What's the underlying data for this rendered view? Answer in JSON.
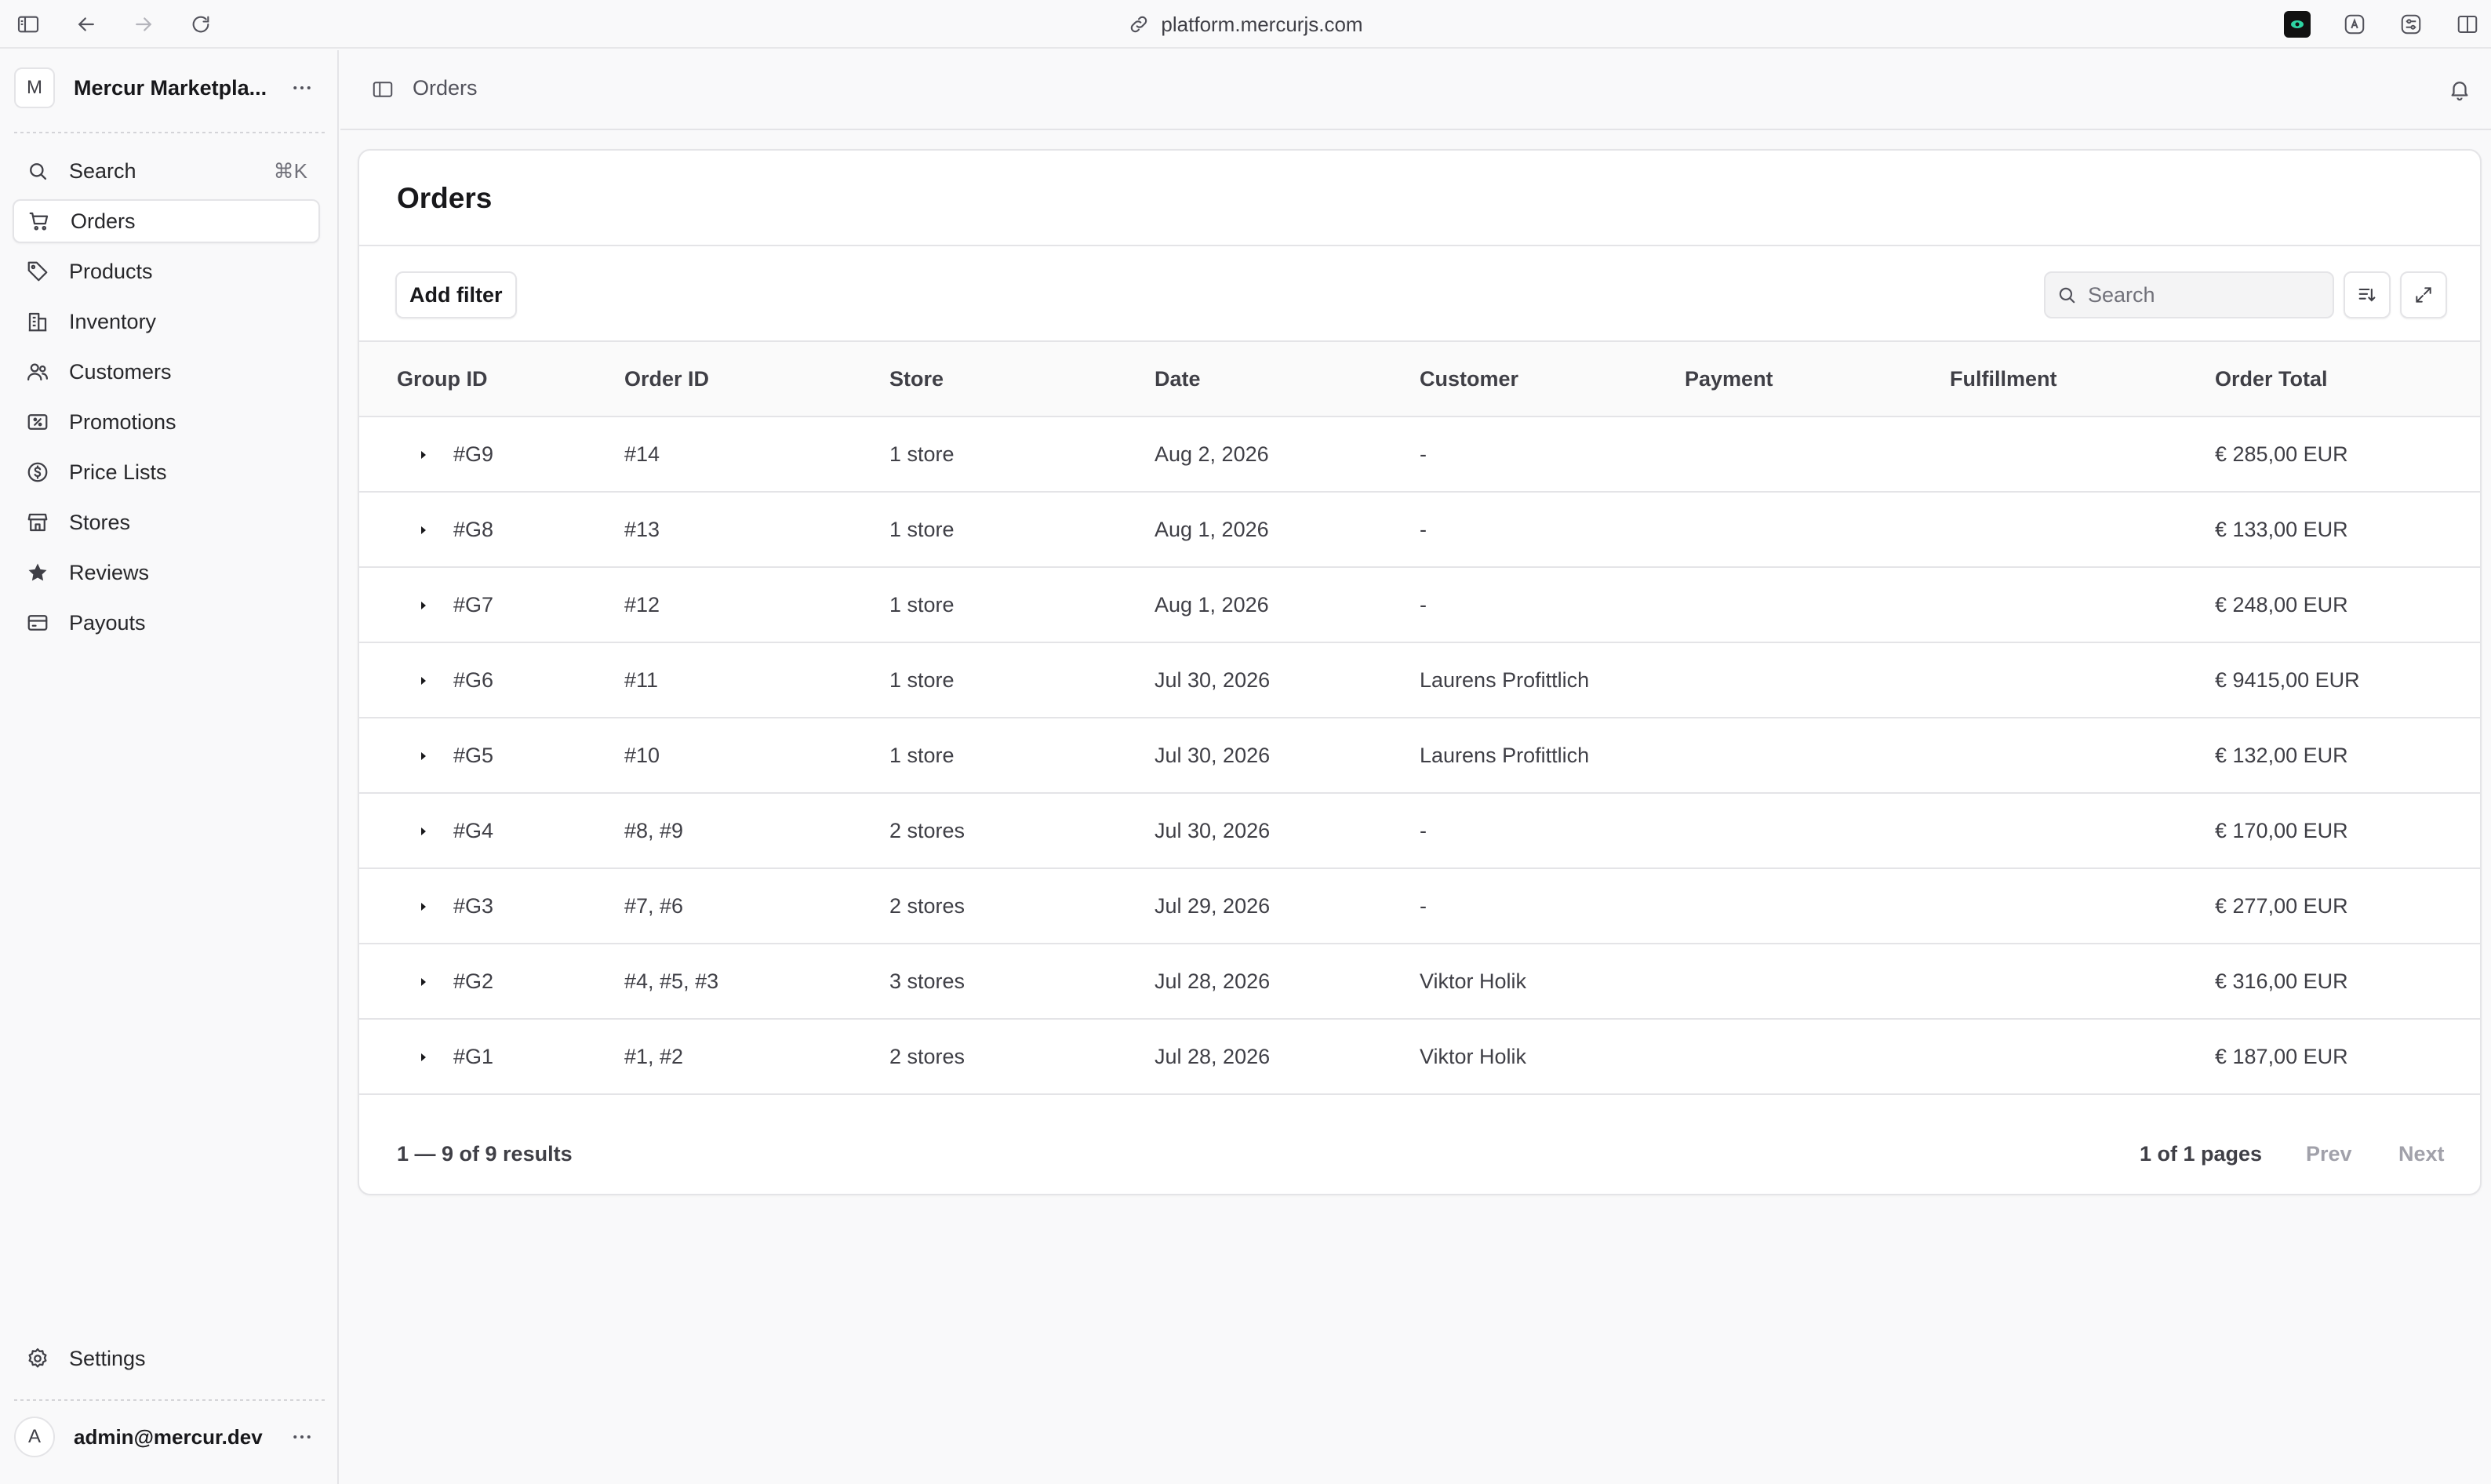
{
  "browser": {
    "url": "platform.mercurjs.com"
  },
  "sidebar": {
    "store_name": "Mercur Marketpla...",
    "store_avatar": "M",
    "search_label": "Search",
    "search_shortcut": "⌘K",
    "items": [
      {
        "label": "Orders",
        "icon": "cart-icon",
        "active": true
      },
      {
        "label": "Products",
        "icon": "tag-icon"
      },
      {
        "label": "Inventory",
        "icon": "buildings-icon"
      },
      {
        "label": "Customers",
        "icon": "users-icon"
      },
      {
        "label": "Promotions",
        "icon": "receipt-percent-icon"
      },
      {
        "label": "Price Lists",
        "icon": "currency-dollar-icon"
      },
      {
        "label": "Stores",
        "icon": "store-icon"
      },
      {
        "label": "Reviews",
        "icon": "star-icon"
      },
      {
        "label": "Payouts",
        "icon": "credit-card-icon"
      }
    ],
    "settings_label": "Settings",
    "user_avatar": "A",
    "user_email": "admin@mercur.dev"
  },
  "topbar": {
    "breadcrumb": "Orders"
  },
  "main": {
    "title": "Orders",
    "add_filter_label": "Add filter",
    "search_placeholder": "Search",
    "columns": [
      "Group ID",
      "Order ID",
      "Store",
      "Date",
      "Customer",
      "Payment",
      "Fulfillment",
      "Order Total"
    ],
    "rows": [
      {
        "group_id": "#G9",
        "order_id": "#14",
        "store": "1 store",
        "date": "Aug 2, 2026",
        "customer": "-",
        "payment": "",
        "fulfillment": "",
        "total": "€ 285,00 EUR"
      },
      {
        "group_id": "#G8",
        "order_id": "#13",
        "store": "1 store",
        "date": "Aug 1, 2026",
        "customer": "-",
        "payment": "",
        "fulfillment": "",
        "total": "€ 133,00 EUR"
      },
      {
        "group_id": "#G7",
        "order_id": "#12",
        "store": "1 store",
        "date": "Aug 1, 2026",
        "customer": "-",
        "payment": "",
        "fulfillment": "",
        "total": "€ 248,00 EUR"
      },
      {
        "group_id": "#G6",
        "order_id": "#11",
        "store": "1 store",
        "date": "Jul 30, 2026",
        "customer": "Laurens Profittlich",
        "payment": "",
        "fulfillment": "",
        "total": "€ 9415,00 EUR"
      },
      {
        "group_id": "#G5",
        "order_id": "#10",
        "store": "1 store",
        "date": "Jul 30, 2026",
        "customer": "Laurens Profittlich",
        "payment": "",
        "fulfillment": "",
        "total": "€ 132,00 EUR"
      },
      {
        "group_id": "#G4",
        "order_id": "#8, #9",
        "store": "2 stores",
        "date": "Jul 30, 2026",
        "customer": "-",
        "payment": "",
        "fulfillment": "",
        "total": "€ 170,00 EUR"
      },
      {
        "group_id": "#G3",
        "order_id": "#7, #6",
        "store": "2 stores",
        "date": "Jul 29, 2026",
        "customer": "-",
        "payment": "",
        "fulfillment": "",
        "total": "€ 277,00 EUR"
      },
      {
        "group_id": "#G2",
        "order_id": "#4, #5, #3",
        "store": "3 stores",
        "date": "Jul 28, 2026",
        "customer": "Viktor Holik",
        "payment": "",
        "fulfillment": "",
        "total": "€ 316,00 EUR"
      },
      {
        "group_id": "#G1",
        "order_id": "#1, #2",
        "store": "2 stores",
        "date": "Jul 28, 2026",
        "customer": "Viktor Holik",
        "payment": "",
        "fulfillment": "",
        "total": "€ 187,00 EUR"
      }
    ],
    "pagination": {
      "results": "1 — 9 of 9 results",
      "pages": "1 of 1 pages",
      "prev_label": "Prev",
      "next_label": "Next"
    }
  }
}
